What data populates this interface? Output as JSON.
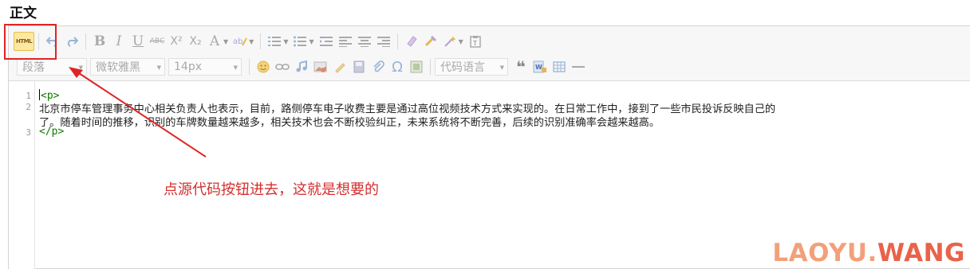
{
  "section_title": "正文",
  "toolbar": {
    "html_label": "HTML",
    "format_select": "段落",
    "font_select": "微软雅黑",
    "size_select": "14px",
    "code_lang_select": "代码语言"
  },
  "code_lines": [
    {
      "num": "1",
      "text": "<p>"
    },
    {
      "num": "2",
      "line1": "    北京市停车管理事务中心相关负责人也表示，目前，路侧停车电子收费主要是通过高位视频技术方式来实现的。在日常工作中，接到了一些市民投诉反映自己的",
      "line2": "了。随着时间的推移，识别的车牌数量越来越多，相关技术也会不断校验纠正，未来系统将不断完善，后续的识别准确率会越来越高。"
    },
    {
      "num": "3",
      "text": "</p>"
    }
  ],
  "annotation": {
    "text": "点源代码按钮进去，这就是想要的",
    "color": "#e02424"
  },
  "watermark": {
    "part1": "LAOYU.",
    "part2": "WANG"
  },
  "icons": [
    "html-icon",
    "undo-icon",
    "redo-icon",
    "bold-icon",
    "italic-icon",
    "underline-icon",
    "strikethrough-icon",
    "superscript-icon",
    "subscript-icon",
    "font-color-icon",
    "highlight-icon",
    "ordered-list-icon",
    "unordered-list-icon",
    "indent-icon",
    "align-left-icon",
    "align-center-icon",
    "align-right-icon",
    "eraser-icon",
    "format-painter-icon",
    "magic-icon",
    "paste-text-icon",
    "emoji-icon",
    "link-icon",
    "music-icon",
    "image-icon",
    "attachment-icon",
    "save-icon",
    "clip-icon",
    "omega-icon",
    "insert-image-icon",
    "quote-icon",
    "word-icon",
    "table-icon",
    "hr-icon"
  ]
}
